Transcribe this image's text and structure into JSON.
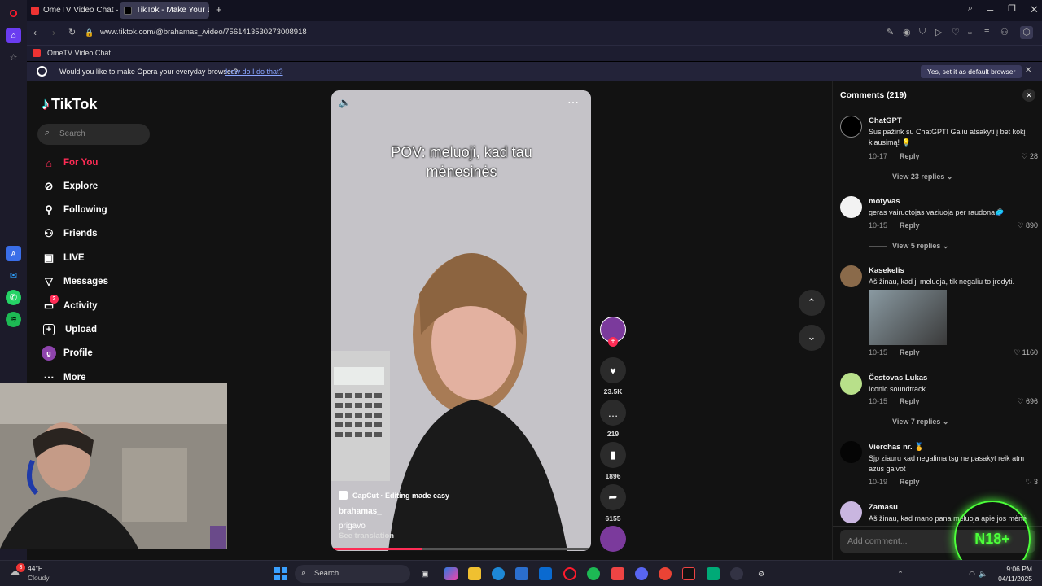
{
  "tabs": [
    {
      "title": "OmeTV Video Chat — On"
    },
    {
      "title": "TikTok - Make Your Da"
    }
  ],
  "address": {
    "url": "www.tiktok.com/@brahamas_/video/7561413530273008918"
  },
  "bookmarks": [
    {
      "label": "OmeTV Video Chat..."
    }
  ],
  "notification": {
    "text": "Would you like to make Opera your everyday browser?",
    "link": "How do I do that?",
    "button": "Yes, set it as default browser"
  },
  "tiktok": {
    "logo": "TikTok",
    "search_placeholder": "Search",
    "nav": [
      {
        "label": "For You",
        "icon": "home-icon"
      },
      {
        "label": "Explore",
        "icon": "compass-icon"
      },
      {
        "label": "Following",
        "icon": "following-icon"
      },
      {
        "label": "Friends",
        "icon": "friends-icon"
      },
      {
        "label": "LIVE",
        "icon": "live-icon"
      },
      {
        "label": "Messages",
        "icon": "messages-icon"
      },
      {
        "label": "Activity",
        "icon": "activity-icon",
        "badge": "2"
      },
      {
        "label": "Upload",
        "icon": "upload-icon"
      },
      {
        "label": "Profile",
        "icon": "profile-icon",
        "avatar_letter": "g"
      },
      {
        "label": "More",
        "icon": "more-icon"
      }
    ],
    "video": {
      "caption": "POV: meluoji, kad tau mėnesinės",
      "capcut": "CapCut · Editing made easy",
      "author": "brahamas_",
      "description": "prigavo",
      "see_translation": "See translation",
      "progress": 0.35
    },
    "actions": {
      "likes": "23.5K",
      "comments": "219",
      "saves": "1896",
      "shares": "6155"
    }
  },
  "comments": {
    "header": "Comments (219)",
    "input_placeholder": "Add comment...",
    "items": [
      {
        "name": "ChatGPT",
        "text": "Susipažink su ChatGPT! Galiu atsakyti į bet kokį klausimą! 💡",
        "date": "10-17",
        "reply": "Reply",
        "likes": "28",
        "view_replies": "View 23 replies"
      },
      {
        "name": "motyvas",
        "text": "geras vairuotojas vaziuoja per raudona🥏",
        "date": "10-15",
        "reply": "Reply",
        "likes": "890",
        "view_replies": "View 5 replies"
      },
      {
        "name": "Kasekelis",
        "text": "Aš žinau, kad ji meluoja, tik negaliu to įrodyti.",
        "date": "10-15",
        "reply": "Reply",
        "likes": "1160"
      },
      {
        "name": "Čestovas Lukas",
        "text": "Iconic soundtrack",
        "date": "10-15",
        "reply": "Reply",
        "likes": "696",
        "view_replies": "View 7 replies"
      },
      {
        "name": "Vierchas nr. 🥇",
        "text": "Sjp ziauru kad negalima tsg ne pasakyt reik atm azus galvot",
        "date": "10-19",
        "reply": "Reply",
        "likes": "3"
      },
      {
        "name": "Zamasu",
        "text": "Aš žinau, kad mano pana meluoja apie jos mėnė",
        "date": "",
        "reply": "",
        "likes": ""
      }
    ]
  },
  "overlay_logo": "N18+",
  "taskbar": {
    "weather_temp": "44°F",
    "weather_desc": "Cloudy",
    "weather_badge": "3",
    "search_placeholder": "Search",
    "time": "9:06 PM",
    "date": "04/11/2025"
  }
}
